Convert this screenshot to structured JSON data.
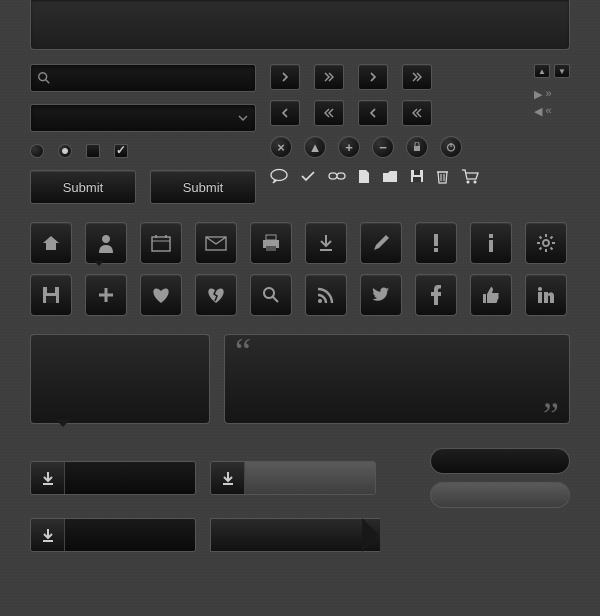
{
  "buttons": {
    "submit1": "Submit",
    "submit2": "Submit"
  },
  "search": {
    "placeholder": ""
  },
  "select": {
    "value": ""
  },
  "icons_row1": [
    "home",
    "user",
    "calendar",
    "mail",
    "print",
    "download",
    "pencil",
    "alert",
    "info",
    "gear"
  ],
  "icons_row2": [
    "save",
    "plus",
    "heart",
    "heart-broken",
    "search",
    "rss",
    "twitter",
    "facebook",
    "thumbs-up",
    "linkedin"
  ],
  "quote": {
    "open": "“",
    "close": "”"
  }
}
